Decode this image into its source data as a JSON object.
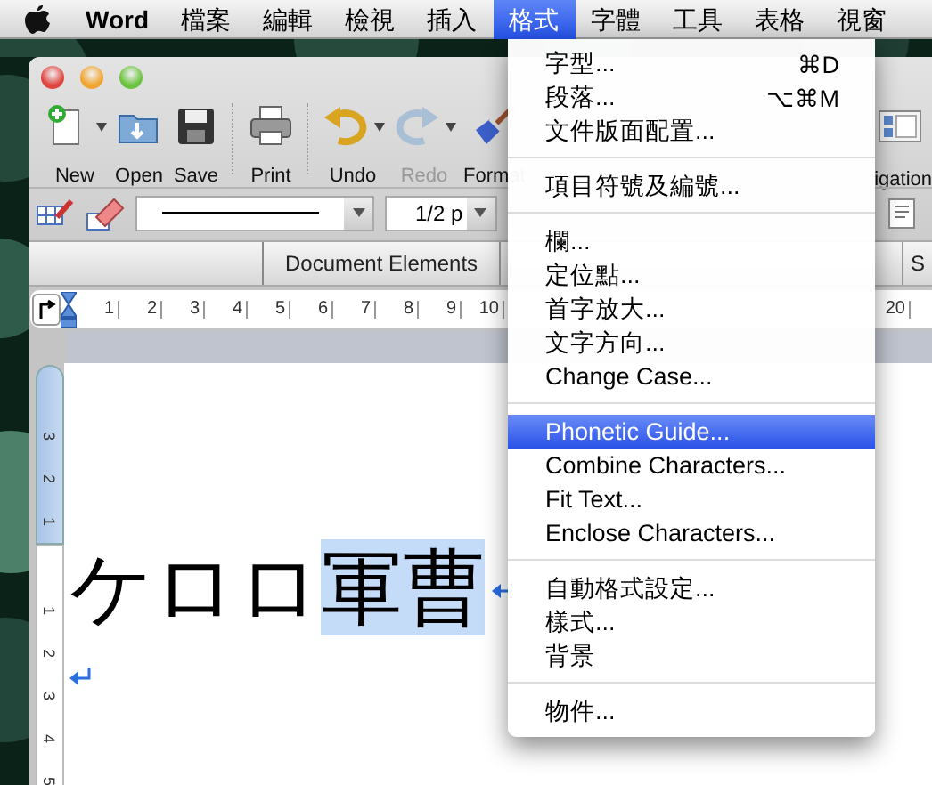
{
  "menu_bar": {
    "app_name": "Word",
    "items": [
      {
        "label": "檔案",
        "selected": false
      },
      {
        "label": "編輯",
        "selected": false
      },
      {
        "label": "檢視",
        "selected": false
      },
      {
        "label": "插入",
        "selected": false
      },
      {
        "label": "格式",
        "selected": true
      },
      {
        "label": "字體",
        "selected": false
      },
      {
        "label": "工具",
        "selected": false
      },
      {
        "label": "表格",
        "selected": false
      },
      {
        "label": "視窗",
        "selected": false
      }
    ]
  },
  "window": {
    "toolbar": {
      "buttons": [
        {
          "label": "New",
          "kind": "new",
          "dropdown": true,
          "disabled": false
        },
        {
          "label": "Open",
          "kind": "open",
          "dropdown": false,
          "disabled": false
        },
        {
          "label": "Save",
          "kind": "save",
          "dropdown": false,
          "disabled": false
        },
        {
          "label": "Print",
          "kind": "print",
          "dropdown": false,
          "disabled": false
        },
        {
          "label": "Undo",
          "kind": "undo",
          "dropdown": true,
          "disabled": false
        },
        {
          "label": "Redo",
          "kind": "redo",
          "dropdown": true,
          "disabled": true
        },
        {
          "label": "Format",
          "kind": "format",
          "dropdown": false,
          "disabled": false
        }
      ],
      "trailing_label": "igation"
    },
    "formatting_toolbar": {
      "line_weight": "1/2 p"
    },
    "ribbon_tabs": [
      {
        "label": "Document Elements"
      },
      {
        "label": "S"
      }
    ],
    "ruler": {
      "numbers": [
        "1",
        "2",
        "3",
        "4",
        "5",
        "6",
        "7",
        "8",
        "9",
        "10"
      ],
      "trailing_number": "20"
    },
    "vertical_ruler": {
      "above": [
        "3",
        "2",
        "1"
      ],
      "below": [
        "1",
        "2",
        "3",
        "4",
        "5"
      ]
    },
    "document": {
      "text": "ケロロ",
      "selected_text": "軍曹"
    }
  },
  "format_menu": {
    "groups": [
      [
        {
          "label": "字型...",
          "shortcut": "⌘D",
          "selected": false
        },
        {
          "label": "段落...",
          "shortcut": "⌥⌘M",
          "selected": false
        },
        {
          "label": "文件版面配置...",
          "selected": false
        }
      ],
      [
        {
          "label": "項目符號及編號...",
          "selected": false
        }
      ],
      [
        {
          "label": "欄...",
          "selected": false
        },
        {
          "label": "定位點...",
          "selected": false
        },
        {
          "label": "首字放大...",
          "selected": false
        },
        {
          "label": "文字方向...",
          "selected": false
        },
        {
          "label": "Change Case...",
          "selected": false
        }
      ],
      [
        {
          "label": "Phonetic Guide...",
          "selected": true
        },
        {
          "label": "Combine Characters...",
          "selected": false
        },
        {
          "label": "Fit Text...",
          "selected": false
        },
        {
          "label": "Enclose Characters...",
          "selected": false
        }
      ],
      [
        {
          "label": "自動格式設定...",
          "selected": false
        },
        {
          "label": "樣式...",
          "selected": false
        },
        {
          "label": "背景",
          "selected": false
        }
      ],
      [
        {
          "label": "物件...",
          "selected": false
        }
      ]
    ]
  }
}
